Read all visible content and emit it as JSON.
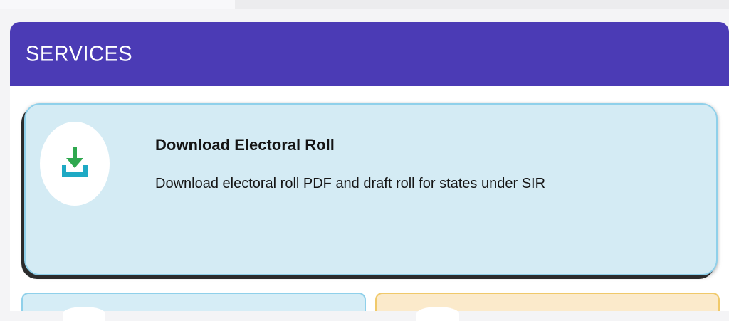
{
  "services": {
    "title": "SERVICES",
    "cards": [
      {
        "title": "Download Electoral Roll",
        "description": "Download electoral roll PDF and draft roll for states under SIR",
        "icon": "download-icon",
        "icon_colors": {
          "arrow": "#2fa84f",
          "tray": "#1ea9c4"
        }
      }
    ]
  },
  "colors": {
    "header": "#4b3bb5",
    "card_blue": "#d4ebf4",
    "card_yellow": "#fbeacb"
  }
}
